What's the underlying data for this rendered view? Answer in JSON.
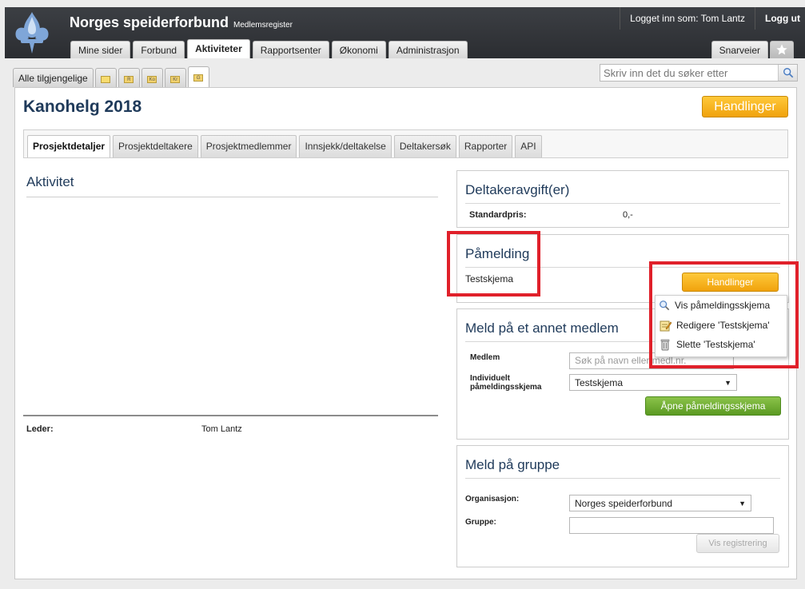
{
  "header": {
    "app_title": "Norges speiderforbund",
    "app_subtitle": "Medlemsregister",
    "logged_in_text": "Logget inn som: Tom Lantz",
    "logout_label": "Logg ut",
    "nav_tabs": [
      "Mine sider",
      "Forbund",
      "Aktiviteter",
      "Rapportsenter",
      "Økonomi",
      "Administrasjon"
    ],
    "active_nav": "Aktiviteter",
    "shortcuts_label": "Snarveier"
  },
  "subtabs": {
    "all_available": "Alle tilgjengelige",
    "icon_tabs": [
      "",
      "R",
      "Ko",
      "Kr",
      "G"
    ]
  },
  "search": {
    "placeholder": "Skriv inn det du søker etter"
  },
  "page": {
    "title": "Kanohelg 2018",
    "actions_label": "Handlinger",
    "tabs": [
      "Prosjektdetaljer",
      "Prosjektdeltakere",
      "Prosjektmedlemmer",
      "Innsjekk/deltakelse",
      "Deltakersøk",
      "Rapporter",
      "API"
    ],
    "active_tab": "Prosjektdetaljer"
  },
  "activity": {
    "title": "Aktivitet",
    "leader_label": "Leder:",
    "leader_value": "Tom Lantz"
  },
  "fee": {
    "title": "Deltakeravgift(er)",
    "standard_label": "Standardpris:",
    "standard_value": "0,-"
  },
  "registration": {
    "title": "Påmelding",
    "form_name": "Testskjema",
    "actions_label": "Handlinger",
    "menu": [
      {
        "label": "Vis påmeldingsskjema",
        "icon": "magnifier-icon"
      },
      {
        "label": "Redigere 'Testskjema'",
        "icon": "edit-icon"
      },
      {
        "label": "Slette 'Testskjema'",
        "icon": "trash-icon"
      }
    ]
  },
  "member_signup": {
    "title": "Meld på et annet medlem",
    "member_label": "Medlem",
    "member_placeholder": "Søk på navn eller medl.nr.",
    "form_label_line1": "Individuelt",
    "form_label_line2": "påmeldingsskjema",
    "form_value": "Testskjema",
    "open_button": "Åpne påmeldingsskjema"
  },
  "group_signup": {
    "title": "Meld på gruppe",
    "org_label": "Organisasjon:",
    "org_value": "Norges speiderforbund",
    "group_label": "Gruppe:",
    "group_value": "",
    "show_button": "Vis registrering"
  },
  "colors": {
    "header_bg": "#2e3034",
    "title_blue": "#1f3a5a",
    "accent_orange": "#f5ad16",
    "accent_green": "#6aab2e",
    "highlight_red": "#e0202a"
  }
}
